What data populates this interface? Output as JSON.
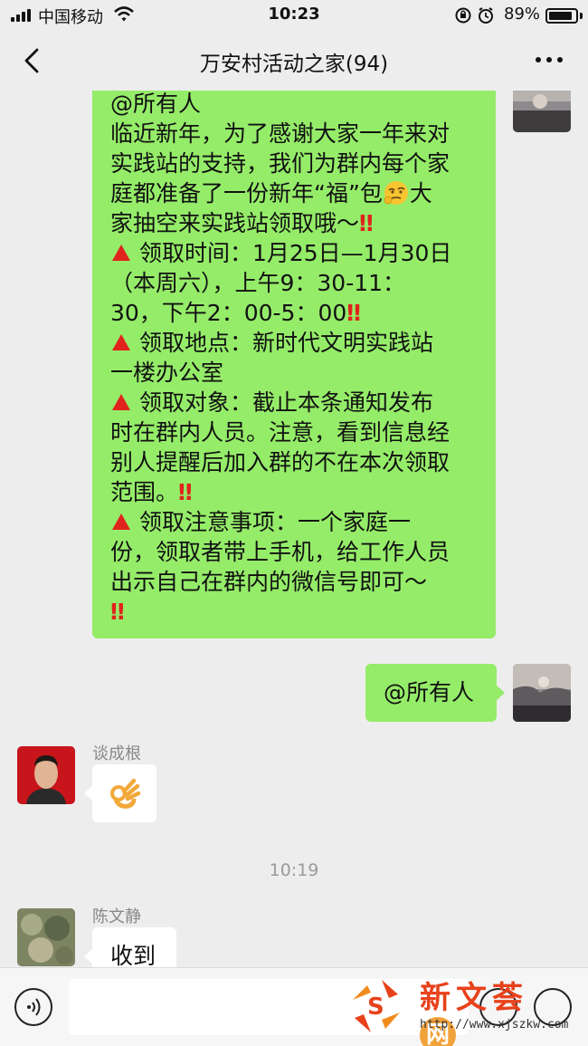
{
  "status_bar": {
    "carrier": "中国移动",
    "time": "10:23",
    "battery_percent": "89%",
    "battery_level": 0.89
  },
  "nav": {
    "title": "万安村活动之家(94)",
    "back_icon": "chevron-left-icon",
    "more_icon": "ellipsis-icon"
  },
  "messages": {
    "notice": {
      "line1": "@所有人",
      "line2": "临近新年，为了感谢大家一年来对",
      "line3": "实践站的支持，我们为群内每个家",
      "line4a": "庭都准备了一份新年“福”包",
      "line5a": "家抽空来实践站领取哦～",
      "line6": "领取时间：1月25日—1月30日",
      "line7": "（本周六），上午9：30-11：",
      "line8": "30，下午2：00-5：00",
      "line9": "领取地点：新时代文明实践站",
      "line10": "一楼办公室",
      "line11": "领取对象：截止本条通知发布",
      "line12": "时在群内人员。注意，看到信息经",
      "line13": "别人提醒后加入群的不在本次领取",
      "line14": "范围。",
      "line15": "领取注意事项：一个家庭一",
      "line16": "份，领取者带上手机，给工作人员",
      "line17": "出示自己在群内的微信号即可～",
      "line4b": "大",
      "double_exclaim": "‼"
    },
    "mention": {
      "text": "@所有人"
    },
    "user1": {
      "name": "谈成根",
      "content": "ok-hand-emoji"
    },
    "time_divider": "10:19",
    "user2": {
      "name": "陈文静",
      "text": "收到"
    }
  },
  "input_bar": {
    "voice_icon": "voice-icon",
    "emoji_icon": "emoji-icon",
    "plus_icon": "plus-icon"
  },
  "watermark": {
    "name": "新文荟",
    "badge": "网",
    "url": "http://www.xjszkw.com"
  },
  "colors": {
    "bubble_green": "#95ec69",
    "background": "#ededed",
    "warning_red": "#e0231c"
  }
}
